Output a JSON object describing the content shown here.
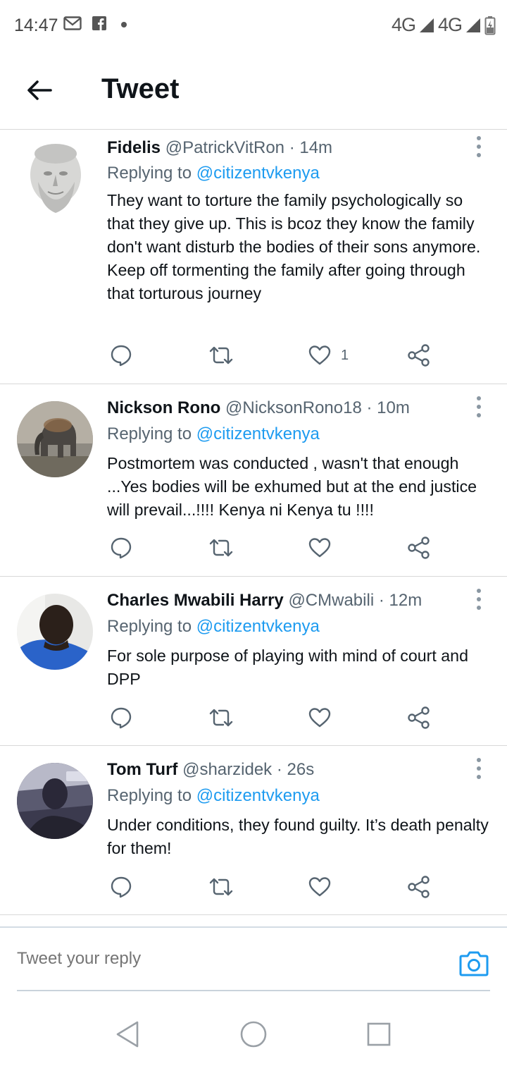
{
  "status_bar": {
    "time": "14:47",
    "network_1": "4G",
    "network_2": "4G"
  },
  "header": {
    "title": "Tweet"
  },
  "tweets": [
    {
      "name": "Fidelis",
      "handle": "@PatrickVitRon",
      "time": "14m",
      "replying_prefix": "Replying to",
      "replying_to": "@citizentvkenya",
      "text": "They want to torture the family psychologically so that they give up. This is bcoz they know the family don't want disturb the bodies of their sons anymore.\nKeep off tormenting the family after going through that torturous journey",
      "like_count": "1",
      "avatar": "statue-avatar"
    },
    {
      "name": "Nickson Rono",
      "handle": "@NicksonRono18",
      "time": "10m",
      "replying_prefix": "Replying to",
      "replying_to": "@citizentvkenya",
      "text": "Postmortem was conducted , wasn't that enough ...Yes bodies will be exhumed but  at the end justice will prevail...!!!! Kenya ni Kenya tu !!!!",
      "like_count": "",
      "avatar": "elephant-avatar"
    },
    {
      "name": "Charles Mwabili Harry",
      "handle": "@CMwabili",
      "time": "12m",
      "replying_prefix": "Replying to",
      "replying_to": "@citizentvkenya",
      "text": "For sole purpose of playing with mind of court and DPP",
      "like_count": "",
      "avatar": "person-avatar"
    },
    {
      "name": "Tom Turf",
      "handle": "@sharzidek",
      "time": "26s",
      "replying_prefix": "Replying to",
      "replying_to": "@citizentvkenya",
      "text": "Under conditions, they found guilty. It’s death penalty for them!",
      "like_count": "",
      "avatar": "car-interior-avatar"
    }
  ],
  "reply_bar": {
    "placeholder": "Tweet your reply"
  },
  "colors": {
    "accent": "#1d9bf0",
    "text": "#0f1419",
    "muted": "#566470",
    "divider": "#d8d8d8"
  }
}
